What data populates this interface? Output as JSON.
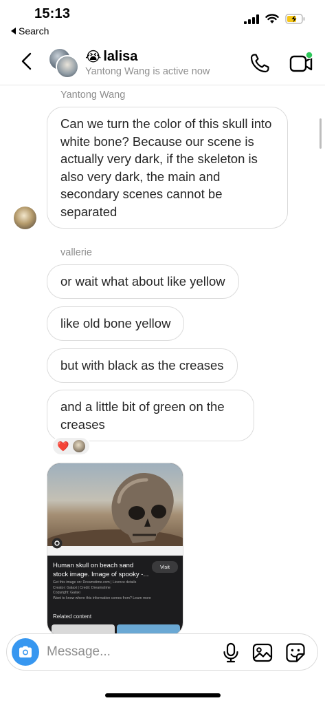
{
  "status_bar": {
    "time": "15:13",
    "back_app": "Search",
    "battery_color": "#f5c518"
  },
  "header": {
    "chat_name": "lalisa",
    "chat_emoji": "😭",
    "status": "Yantong Wang is active now",
    "active_dot_color": "#2ec65a"
  },
  "messages": [
    {
      "sender": "Yantong Wang",
      "bubbles": [
        "Can we turn the color of this skull into white bone? Because our scene is actually very dark, if the skeleton is also very dark, the main and secondary scenes cannot be separated"
      ]
    },
    {
      "sender": "vallerie",
      "bubbles": [
        "or wait what about like yellow",
        "like old bone yellow",
        "but with black as the creases",
        "and a little bit of green on the creases"
      ],
      "reaction": "❤️"
    }
  ],
  "shared_image": {
    "title": "Human skull on beach sand stock image. Image of spooky -...",
    "visit_label": "Visit",
    "meta_lines": [
      "Get this image on: Dreamstime.com | Licence details",
      "Creator: Galaxi | Credit: Dreamstime",
      "Copyright: Galaxi",
      "Want to know where this information comes from? Learn more"
    ],
    "related_label": "Related content"
  },
  "composer": {
    "placeholder": "Message...",
    "accent_color": "#3797f0"
  }
}
